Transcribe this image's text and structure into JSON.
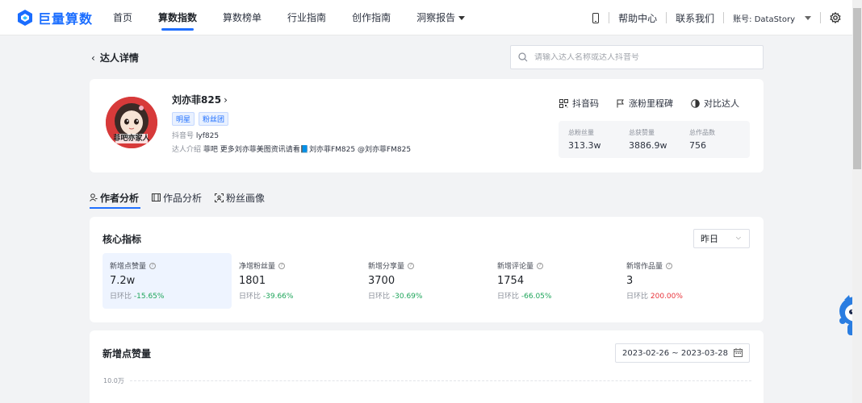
{
  "brand": {
    "name": "巨量算数"
  },
  "nav": {
    "items": [
      {
        "label": "首页",
        "active": false
      },
      {
        "label": "算数指数",
        "active": true
      },
      {
        "label": "算数榜单",
        "active": false
      },
      {
        "label": "行业指南",
        "active": false
      },
      {
        "label": "创作指南",
        "active": false
      },
      {
        "label": "洞察报告",
        "active": false,
        "dropdown": true
      }
    ],
    "help": "帮助中心",
    "contact": "联系我们",
    "account": "账号: DataStory"
  },
  "page": {
    "back_label": "达人详情",
    "search_placeholder": "请输入达人名称或达人抖音号"
  },
  "profile": {
    "name": "刘亦菲825",
    "tags": [
      "明星",
      "粉丝团"
    ],
    "douyin_id_label": "抖音号",
    "douyin_id": "lyf825",
    "intro_label": "达人介绍",
    "intro": "菲吧 更多刘亦菲美图资讯请看📘刘亦菲FM825 @刘亦菲FM825",
    "avatar_text": "菲吧亦家人",
    "actions": [
      "抖音码",
      "涨粉里程碑",
      "对比达人"
    ],
    "stats": [
      {
        "label": "总粉丝量",
        "value": "313.3w"
      },
      {
        "label": "总获赞量",
        "value": "3886.9w"
      },
      {
        "label": "总作品数",
        "value": "756"
      }
    ]
  },
  "tabs": [
    {
      "label": "作者分析",
      "active": true,
      "icon": "user-icon"
    },
    {
      "label": "作品分析",
      "active": false,
      "icon": "film-icon"
    },
    {
      "label": "粉丝画像",
      "active": false,
      "icon": "portrait-icon"
    }
  ],
  "core": {
    "title": "核心指标",
    "period": "昨日",
    "compare_label": "日环比",
    "metrics": [
      {
        "label": "新增点赞量",
        "value": "7.2w",
        "change": "-15.65%",
        "trend": "down",
        "active": true
      },
      {
        "label": "净增粉丝量",
        "value": "1801",
        "change": "-39.66%",
        "trend": "down",
        "active": false
      },
      {
        "label": "新增分享量",
        "value": "3700",
        "change": "-30.69%",
        "trend": "down",
        "active": false
      },
      {
        "label": "新增评论量",
        "value": "1754",
        "change": "-66.05%",
        "trend": "down",
        "active": false
      },
      {
        "label": "新增作品量",
        "value": "3",
        "change": "200.00%",
        "trend": "up",
        "active": false
      }
    ]
  },
  "likes_chart": {
    "title": "新增点赞量",
    "date_range": "2023-02-26 ~ 2023-03-28",
    "y_tick": "10.0万"
  },
  "colors": {
    "accent": "#1f6fff",
    "down": "#1ea55a",
    "up": "#e8333a"
  }
}
